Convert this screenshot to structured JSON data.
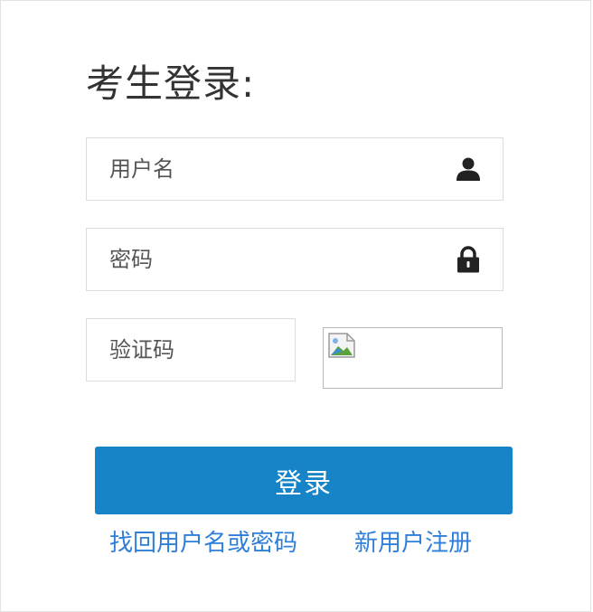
{
  "login": {
    "title": "考生登录:",
    "username": {
      "placeholder": "用户名",
      "value": "",
      "icon": "user-icon"
    },
    "password": {
      "placeholder": "密码",
      "value": "",
      "icon": "lock-icon"
    },
    "captcha": {
      "placeholder": "验证码",
      "value": "",
      "image": "broken-image-icon"
    },
    "submit_label": "登录",
    "links": {
      "recover": "找回用户名或密码",
      "register": "新用户注册"
    }
  },
  "colors": {
    "accent": "#1784c7",
    "link": "#2f7fd8",
    "border": "#dcdcdc",
    "text": "#333333"
  }
}
